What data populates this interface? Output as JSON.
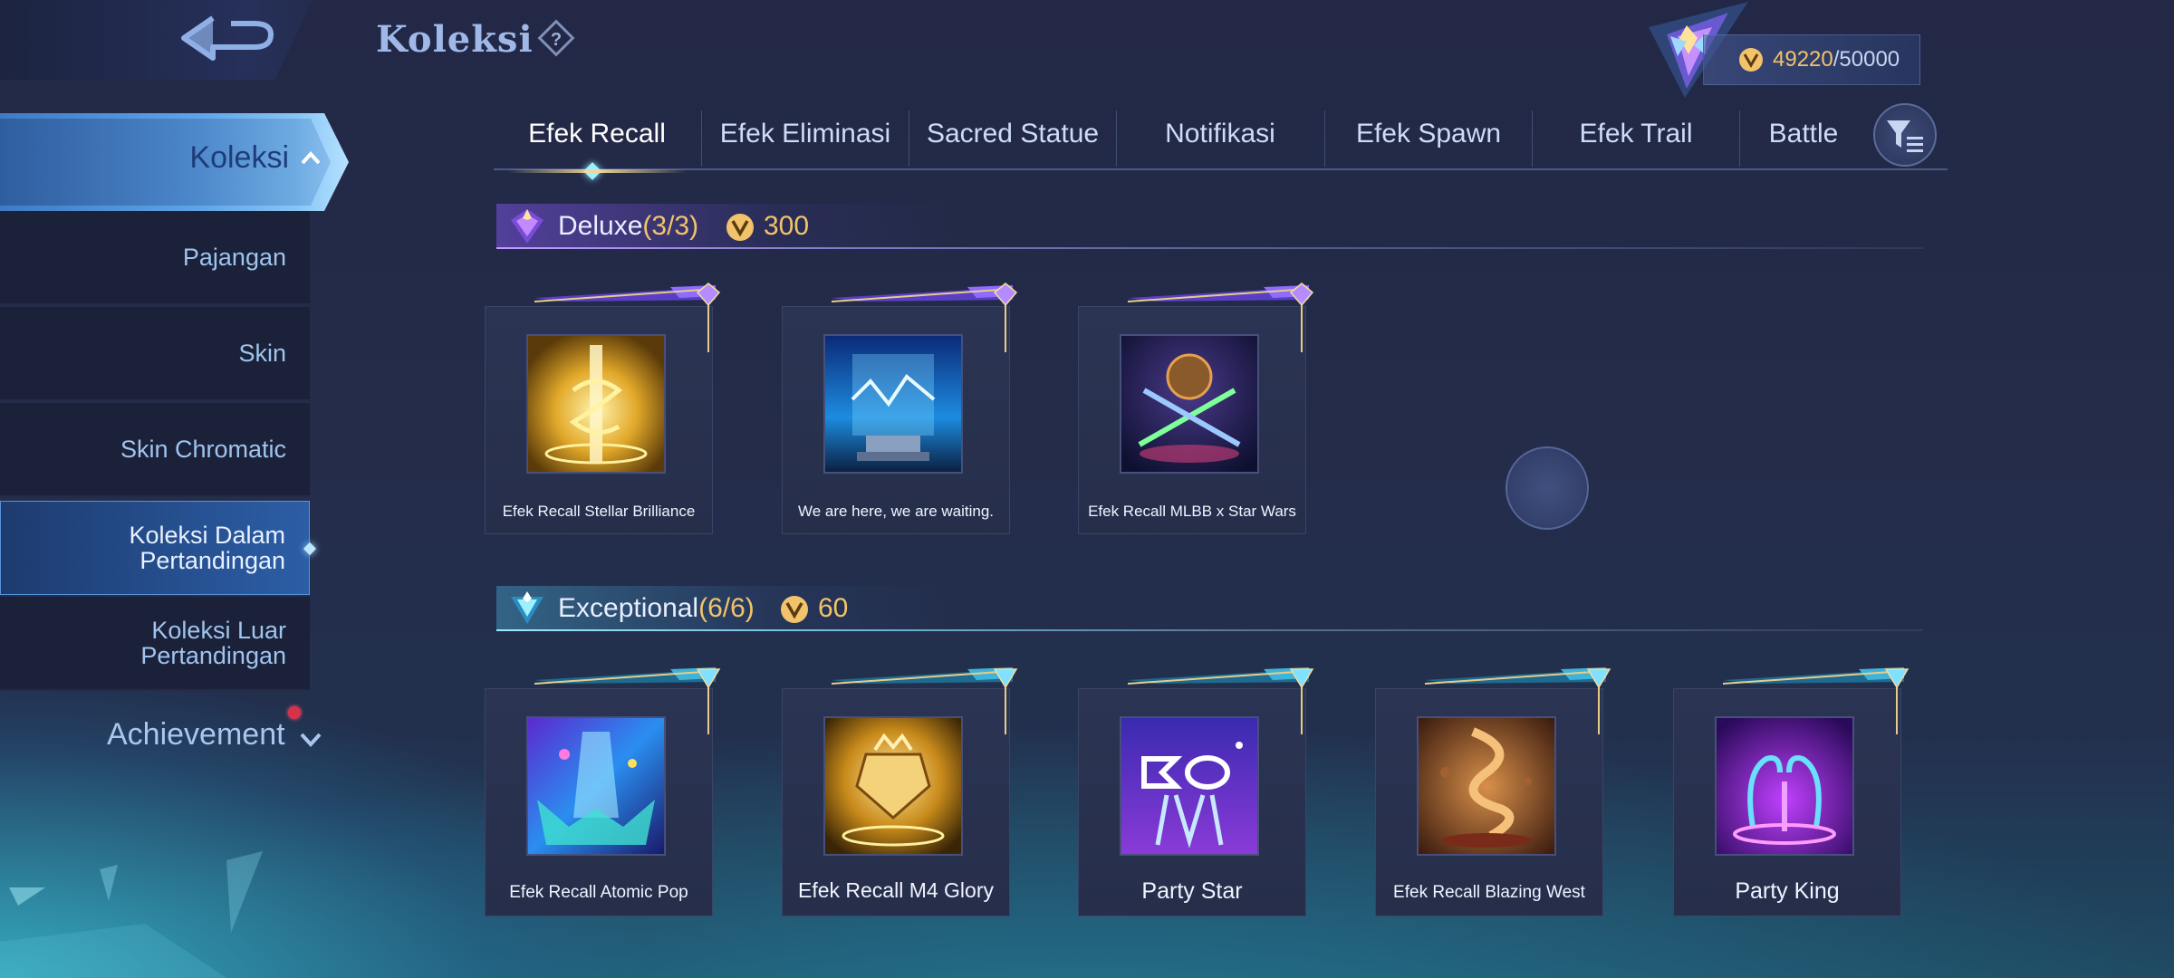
{
  "header": {
    "title": "Koleksi",
    "points_current": "49220",
    "points_max": "/50000"
  },
  "sidebar": {
    "main_label": "Koleksi",
    "items": [
      {
        "label": "Pajangan"
      },
      {
        "label": "Skin"
      },
      {
        "label": "Skin Chromatic"
      },
      {
        "label": "Koleksi Dalam Pertandingan"
      },
      {
        "label": "Koleksi Luar Pertandingan"
      }
    ],
    "achievement_label": "Achievement"
  },
  "tabs": [
    {
      "label": "Efek Recall"
    },
    {
      "label": "Efek Eliminasi"
    },
    {
      "label": "Sacred Statue"
    },
    {
      "label": "Notifikasi"
    },
    {
      "label": "Efek Spawn"
    },
    {
      "label": "Efek Trail"
    },
    {
      "label": "Battle"
    }
  ],
  "sections": [
    {
      "name": "Deluxe",
      "count": "(3/3)",
      "cost": "300",
      "items": [
        {
          "label": "Efek Recall Stellar Brilliance"
        },
        {
          "label": "We are here, we are waiting."
        },
        {
          "label": "Efek Recall MLBB x Star Wars"
        }
      ]
    },
    {
      "name": "Exceptional",
      "count": "(6/6)",
      "cost": "60",
      "items": [
        {
          "label": "Efek Recall Atomic Pop"
        },
        {
          "label": "Efek Recall M4 Glory"
        },
        {
          "label": "Party Star"
        },
        {
          "label": "Efek Recall Blazing West"
        },
        {
          "label": "Party King"
        }
      ]
    }
  ],
  "colors": {
    "accent_gold": "#f2c36a",
    "deluxe_purple": "#b07cff",
    "exceptional_cyan": "#8fe4ff"
  },
  "icons": {
    "back": "back-arrow-icon",
    "help": "question-diamond-icon",
    "points": "collector-points-icon",
    "filter": "filter-icon"
  }
}
